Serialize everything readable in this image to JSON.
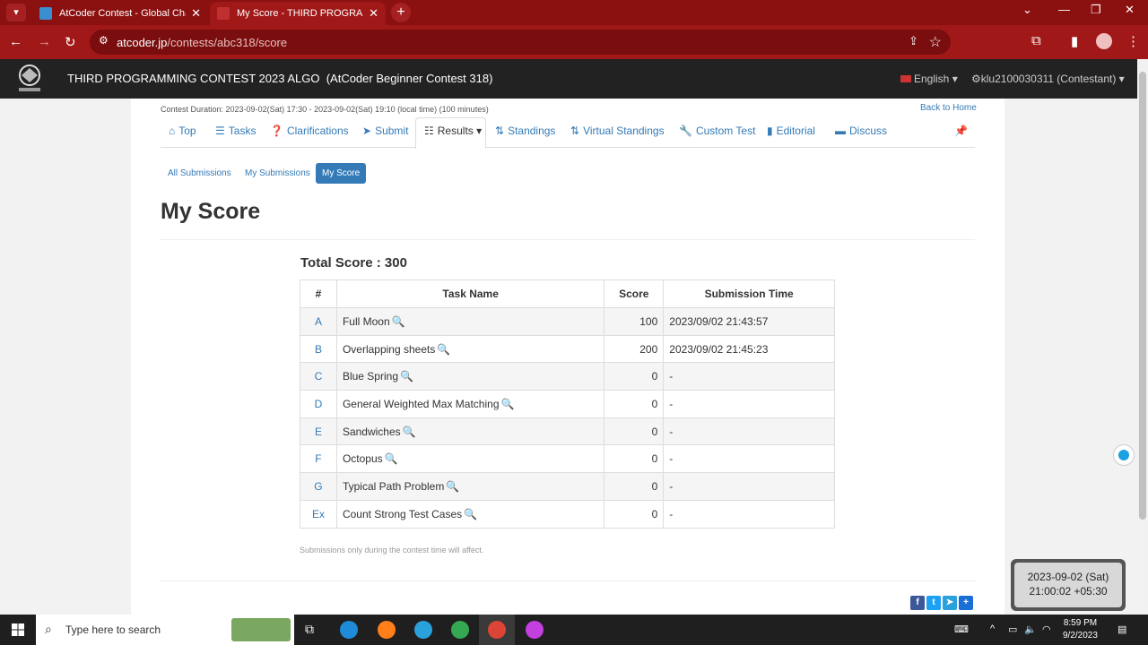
{
  "browser": {
    "tabs": [
      {
        "title": "AtCoder Contest - Global Challe",
        "active": false
      },
      {
        "title": "My Score - THIRD PROGRAMMI",
        "active": true
      }
    ],
    "url_host": "atcoder.jp",
    "url_path": "/contests/abc318/score"
  },
  "header": {
    "title": "THIRD PROGRAMMING CONTEST 2023 ALGO  (AtCoder Beginner Contest 318)",
    "language": "English",
    "user": "klu2100030311 (Contestant)"
  },
  "contest": {
    "duration": "Contest Duration: 2023-09-02(Sat) 17:30 - 2023-09-02(Sat) 19:10 (local time) (100 minutes)",
    "back_to_home": "Back to Home"
  },
  "nav": {
    "top": "Top",
    "tasks": "Tasks",
    "clarifications": "Clarifications",
    "submit": "Submit",
    "results": "Results",
    "standings": "Standings",
    "virtual_standings": "Virtual Standings",
    "custom_test": "Custom Test",
    "editorial": "Editorial",
    "discuss": "Discuss"
  },
  "subnav": {
    "all": "All Submissions",
    "mine": "My Submissions",
    "score": "My Score"
  },
  "page": {
    "title": "My Score",
    "total_score": "Total Score : 300",
    "note": "Submissions only during the contest time will affect."
  },
  "table": {
    "headers": [
      "#",
      "Task Name",
      "Score",
      "Submission Time"
    ],
    "rows": [
      {
        "id": "A",
        "name": "Full Moon",
        "score": "100",
        "time": "2023/09/02 21:43:57"
      },
      {
        "id": "B",
        "name": "Overlapping sheets",
        "score": "200",
        "time": "2023/09/02 21:45:23"
      },
      {
        "id": "C",
        "name": "Blue Spring",
        "score": "0",
        "time": "-"
      },
      {
        "id": "D",
        "name": "General Weighted Max Matching",
        "score": "0",
        "time": "-"
      },
      {
        "id": "E",
        "name": "Sandwiches",
        "score": "0",
        "time": "-"
      },
      {
        "id": "F",
        "name": "Octopus",
        "score": "0",
        "time": "-"
      },
      {
        "id": "G",
        "name": "Typical Path Problem",
        "score": "0",
        "time": "-"
      },
      {
        "id": "Ex",
        "name": "Count Strong Test Cases",
        "score": "0",
        "time": "-"
      }
    ]
  },
  "overlay_clock": {
    "date": "2023-09-02 (Sat)",
    "time": "21:00:02 +05:30"
  },
  "taskbar": {
    "search_placeholder": "Type here to search",
    "time": "8:59 PM",
    "date": "9/2/2023"
  },
  "colors": {
    "browser_frame": "#a01818",
    "site_header": "#222222",
    "link": "#337ab7"
  }
}
